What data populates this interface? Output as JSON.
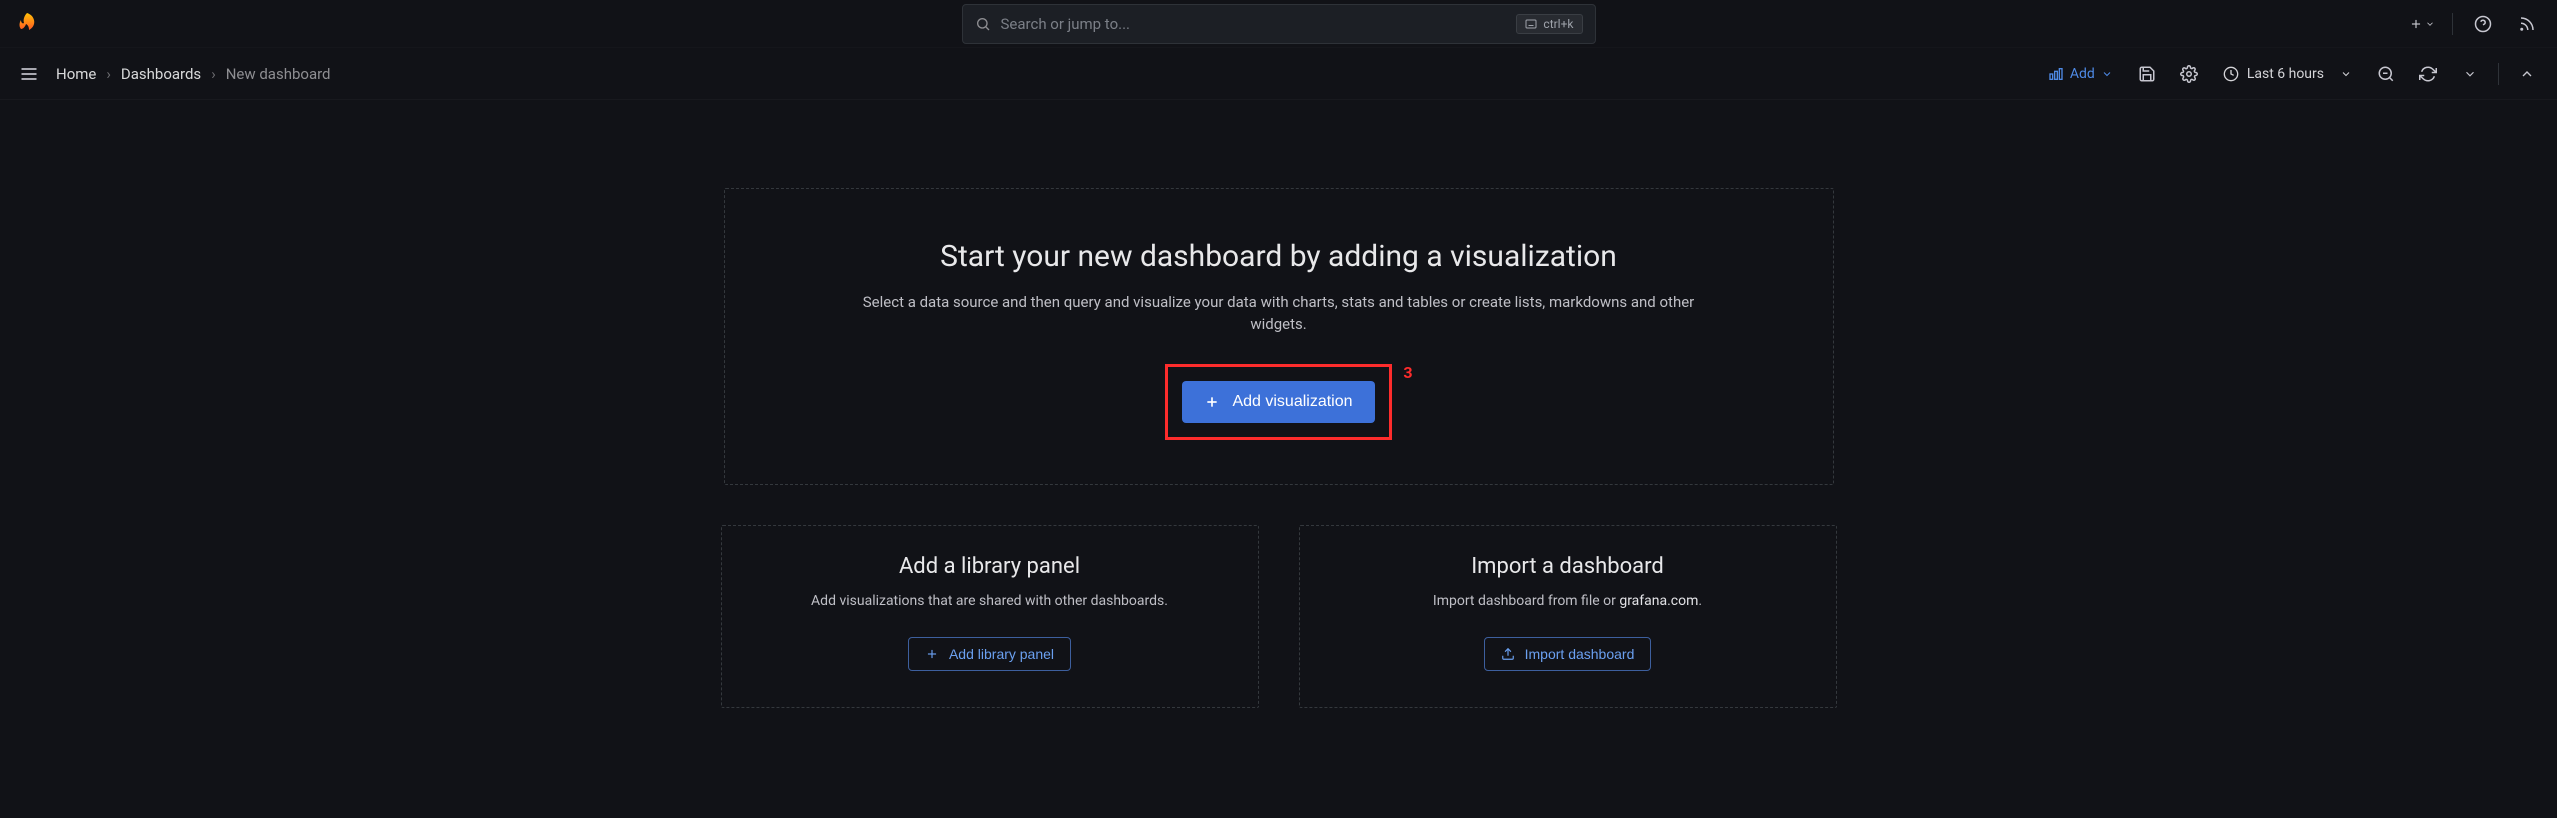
{
  "top": {
    "search_placeholder": "Search or jump to...",
    "search_shortcut": "ctrl+k"
  },
  "crumbs": {
    "home": "Home",
    "dashboards": "Dashboards",
    "current": "New dashboard"
  },
  "toolbar": {
    "add_label": "Add",
    "time_range": "Last 6 hours"
  },
  "main_card": {
    "title": "Start your new dashboard by adding a visualization",
    "desc": "Select a data source and then query and visualize your data with charts, stats and tables or create lists, markdowns and other widgets.",
    "button": "Add visualization",
    "highlight_marker": "3"
  },
  "library_card": {
    "title": "Add a library panel",
    "desc": "Add visualizations that are shared with other dashboards.",
    "button": "Add library panel"
  },
  "import_card": {
    "title": "Import a dashboard",
    "desc_pre": "Import dashboard from file or ",
    "desc_strong": "grafana.com",
    "desc_post": ".",
    "button": "Import dashboard"
  }
}
